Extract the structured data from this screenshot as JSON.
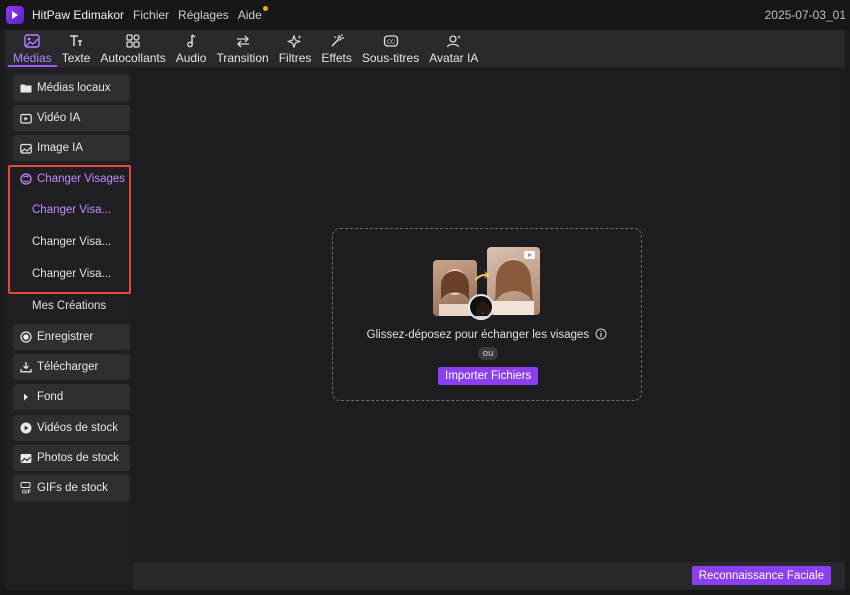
{
  "titlebar": {
    "app_name": "HitPaw Edimakor",
    "menus": [
      "Fichier",
      "Réglages",
      "Aide"
    ],
    "right_text": "2025-07-03_01"
  },
  "toolbar": {
    "tabs": [
      {
        "label": "Médias",
        "icon": "image-icon",
        "active": true
      },
      {
        "label": "Texte",
        "icon": "text-icon"
      },
      {
        "label": "Autocollants",
        "icon": "sticker-icon"
      },
      {
        "label": "Audio",
        "icon": "music-icon"
      },
      {
        "label": "Transition",
        "icon": "transition-icon"
      },
      {
        "label": "Filtres",
        "icon": "sparkle-icon"
      },
      {
        "label": "Effets",
        "icon": "effects-icon"
      },
      {
        "label": "Sous-titres",
        "icon": "subtitles-icon"
      },
      {
        "label": "Avatar IA",
        "icon": "avatar-icon"
      }
    ]
  },
  "sidebar": {
    "items": [
      {
        "label": "Médias locaux",
        "icon": "folder-icon"
      },
      {
        "label": "Vidéo IA",
        "icon": "video-ai-icon"
      },
      {
        "label": "Image IA",
        "icon": "image-ai-icon"
      }
    ],
    "group": {
      "label": "Changer Visages",
      "icon": "face-swap-icon",
      "children": [
        "Changer Visa...",
        "Changer Visa...",
        "Changer Visa..."
      ]
    },
    "mes_creations": "Mes Créations",
    "items2": [
      {
        "label": "Enregistrer",
        "icon": "record-icon"
      },
      {
        "label": "Télécharger",
        "icon": "download-icon"
      },
      {
        "label": "Fond",
        "icon": "caret-right-icon"
      },
      {
        "label": "Vidéos de stock",
        "icon": "play-circle-icon"
      },
      {
        "label": "Photos de stock",
        "icon": "photo-icon"
      },
      {
        "label": "GIFs de stock",
        "icon": "gif-icon"
      }
    ]
  },
  "dropzone": {
    "text": "Glissez-déposez pour échanger les visages",
    "or": "ou",
    "button": "Importer Fichiers"
  },
  "footer": {
    "button": "Reconnaissance Faciale"
  },
  "colors": {
    "accent": "#8a3ff0",
    "accent_text": "#c08bff",
    "highlight_box": "#e24b3c"
  }
}
